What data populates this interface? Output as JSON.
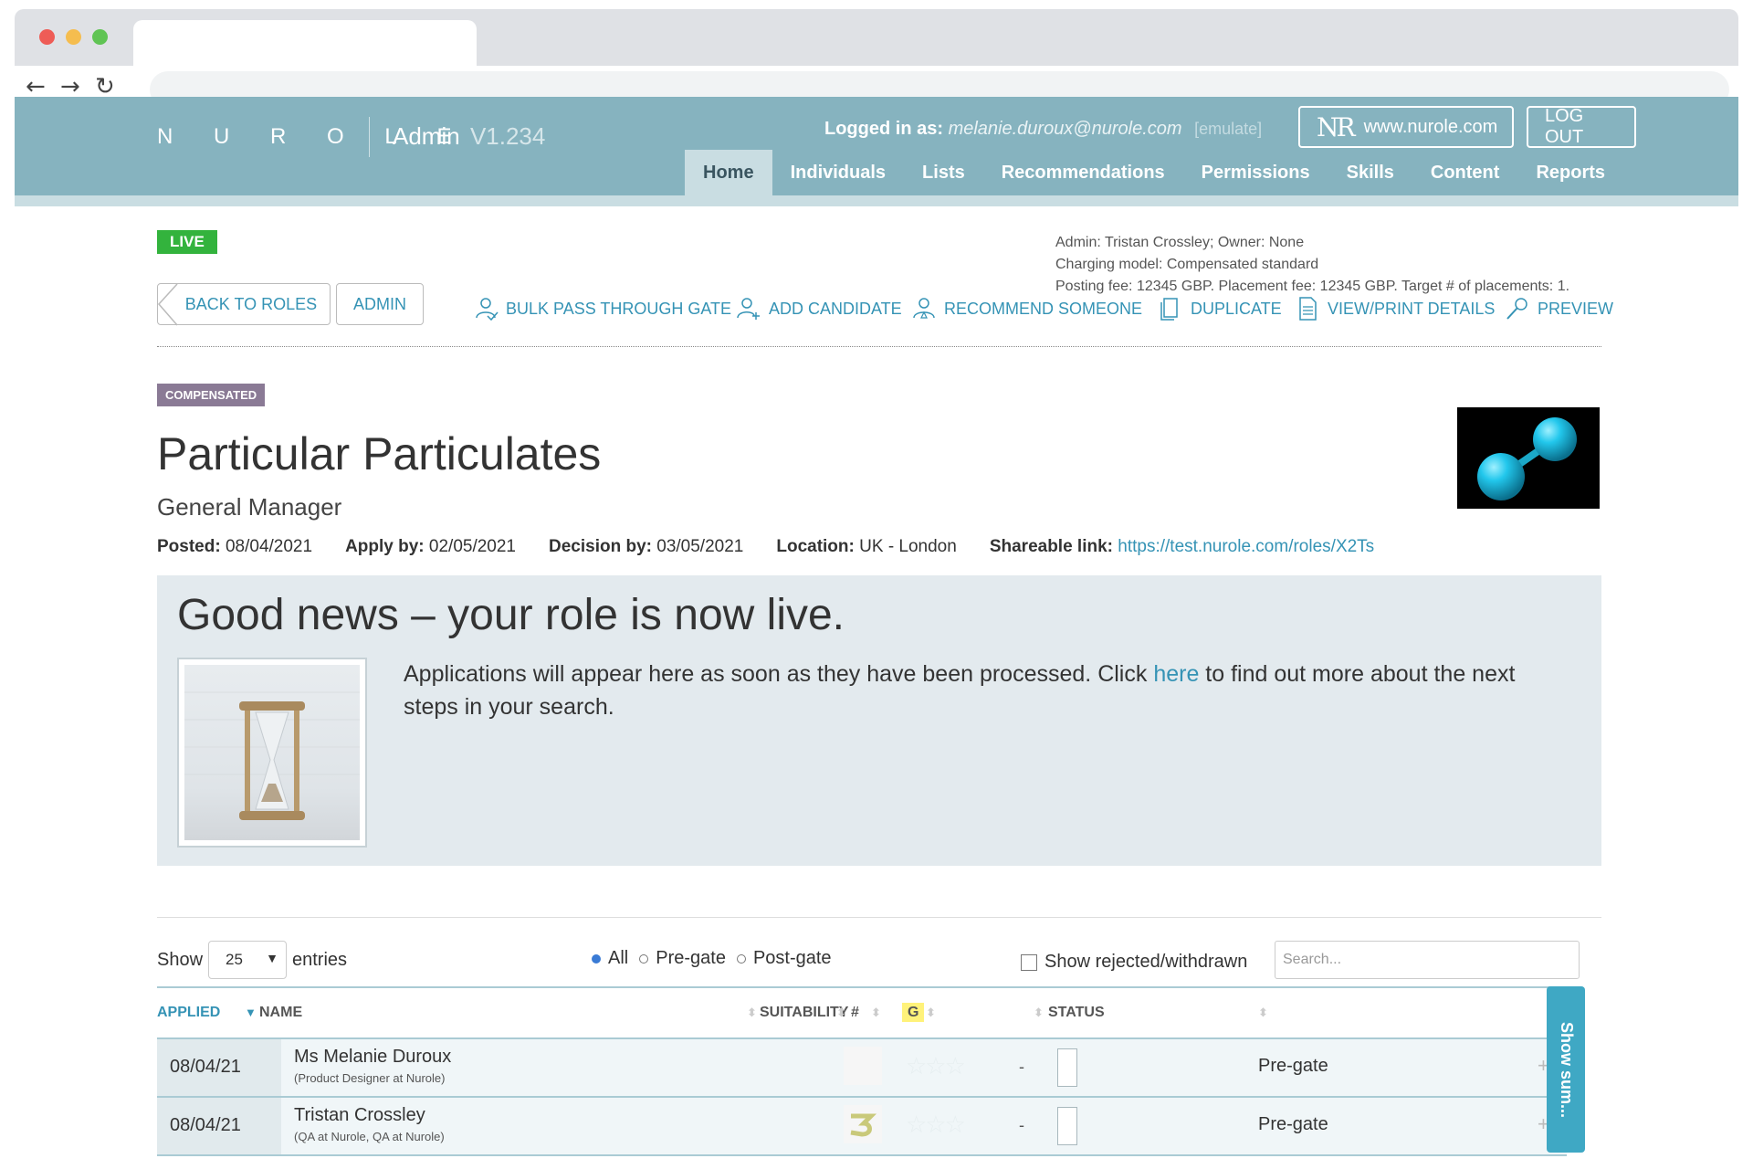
{
  "header": {
    "logo": "N U R O L E",
    "admin_label": "Admin",
    "version": "V1.234",
    "logged_in_label": "Logged in as:",
    "logged_in_email": "melanie.duroux@nurole.com",
    "emulate": "[emulate]",
    "site_logo": "NR",
    "site_link": "www.nurole.com",
    "logout": "LOG OUT",
    "nav": [
      "Home",
      "Individuals",
      "Lists",
      "Recommendations",
      "Permissions",
      "Skills",
      "Content",
      "Reports"
    ],
    "active_nav": "Home"
  },
  "status_badge": "LIVE",
  "admin_meta": {
    "line1": "Admin: Tristan Crossley; Owner: None",
    "line2": "Charging model: Compensated standard",
    "line3": "Posting fee: 12345 GBP. Placement fee: 12345 GBP. Target # of placements: 1."
  },
  "toolbar": {
    "back": "BACK TO ROLES",
    "admin": "ADMIN",
    "bulk_pass": "BULK PASS THROUGH GATE",
    "add_candidate": "ADD CANDIDATE",
    "recommend": "RECOMMEND SOMEONE",
    "duplicate": "DUPLICATE",
    "view_print": "VIEW/PRINT DETAILS",
    "preview": "PREVIEW"
  },
  "role": {
    "badge": "COMPENSATED",
    "title": "Particular Particulates",
    "subtitle": "General Manager",
    "posted_label": "Posted:",
    "posted": "08/04/2021",
    "apply_label": "Apply by:",
    "apply": "02/05/2021",
    "decision_label": "Decision by:",
    "decision": "03/05/2021",
    "location_label": "Location:",
    "location": "UK - London",
    "share_label": "Shareable link:",
    "share_url": "https://test.nurole.com/roles/X2Ts"
  },
  "news": {
    "title": "Good news – your role is now live.",
    "text_before": "Applications will appear here as soon as they have been processed. Click ",
    "link": "here",
    "text_after": " to find out more about the next steps in your search."
  },
  "table_controls": {
    "show": "Show",
    "entries_value": "25",
    "entries": "entries",
    "filters": [
      "All",
      "Pre-gate",
      "Post-gate"
    ],
    "selected_filter": "All",
    "show_rejected": "Show rejected/withdrawn",
    "search_placeholder": "Search..."
  },
  "table": {
    "columns": [
      "APPLIED",
      "NAME",
      "SUITABILITY",
      "#",
      "G",
      "STATUS"
    ],
    "rows": [
      {
        "date": "08/04/21",
        "name": "Ms Melanie Duroux",
        "sub": "(Product Designer at Nurole)",
        "hash": "-",
        "status": "Pre-gate"
      },
      {
        "date": "08/04/21",
        "name": "Tristan Crossley",
        "sub": "(QA at Nurole, QA at Nurole)",
        "hash": "-",
        "status": "Pre-gate"
      }
    ]
  },
  "side_tab": "Show sum...",
  "colors": {
    "header_bg": "#86b3bf",
    "accent": "#3593b5",
    "live": "#33b33d",
    "compensated": "#8a7a95",
    "panel": "#e3eaee"
  }
}
